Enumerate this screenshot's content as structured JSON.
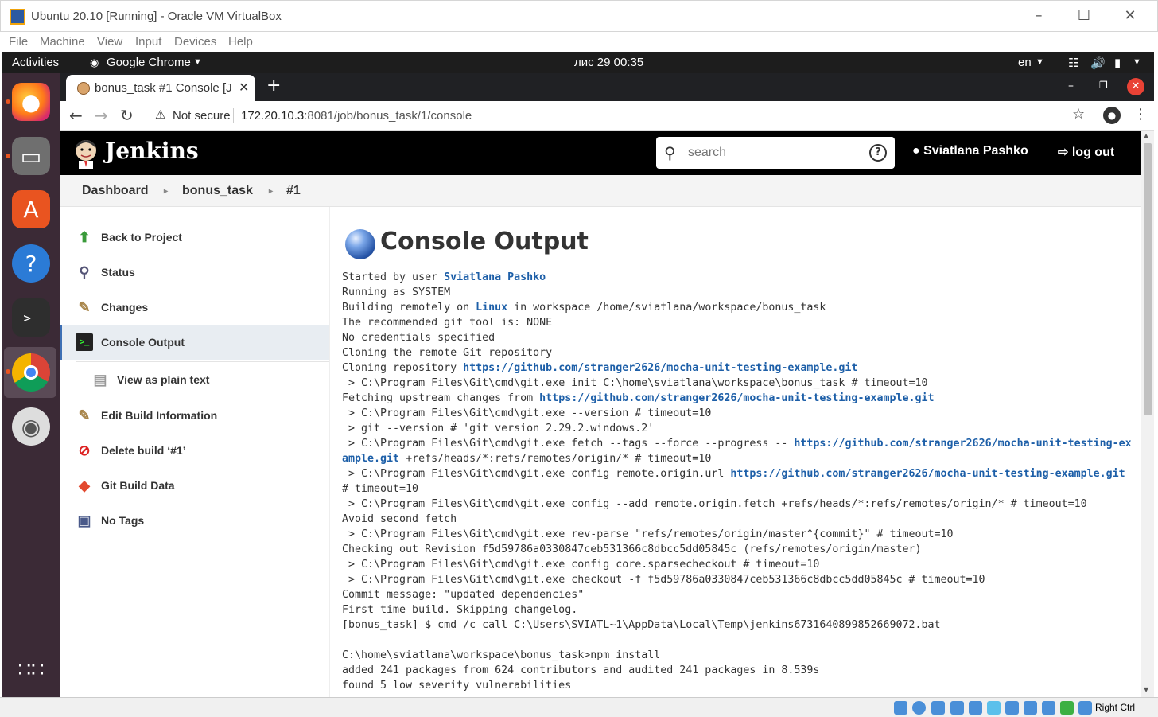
{
  "vbox": {
    "title": "Ubuntu 20.10 [Running] - Oracle VM VirtualBox",
    "menu": [
      "File",
      "Machine",
      "View",
      "Input",
      "Devices",
      "Help"
    ],
    "host_key": "Right Ctrl"
  },
  "gnome": {
    "activities": "Activities",
    "app": "Google Chrome",
    "clock": "лис 29  00:35",
    "lang": "en"
  },
  "dock": {
    "apps": [
      "firefox-icon",
      "files-icon",
      "software-icon",
      "help-icon",
      "terminal-icon",
      "chrome-icon",
      "dvd-icon",
      "app-grid-icon"
    ]
  },
  "browser": {
    "tab_title": "bonus_task #1 Console [J",
    "not_secure": "Not secure",
    "url_host": "172.20.10.3",
    "url_path": ":8081/job/bonus_task/1/console"
  },
  "jenkins": {
    "brand": "Jenkins",
    "search_placeholder": "search",
    "user": "Sviatlana Pashko",
    "logout": "log out",
    "breadcrumb": [
      "Dashboard",
      "bonus_task",
      "#1"
    ],
    "sidebar": [
      {
        "label": "Back to Project",
        "icon": "up-arrow-icon"
      },
      {
        "label": "Status",
        "icon": "magnifier-icon"
      },
      {
        "label": "Changes",
        "icon": "notepad-icon"
      },
      {
        "label": "Console Output",
        "icon": "terminal-icon"
      },
      {
        "label": "View as plain text",
        "icon": "document-icon"
      },
      {
        "label": "Edit Build Information",
        "icon": "notepad-icon"
      },
      {
        "label": "Delete build ‘#1’",
        "icon": "no-entry-icon"
      },
      {
        "label": "Git Build Data",
        "icon": "git-icon"
      },
      {
        "label": "No Tags",
        "icon": "save-icon"
      }
    ],
    "heading": "Console Output",
    "console": [
      "Started by user [Sviatlana Pashko]",
      "Running as SYSTEM",
      "Building remotely on [Linux] in workspace /home/sviatlana/workspace/bonus_task",
      "The recommended git tool is: NONE",
      "No credentials specified",
      "Cloning the remote Git repository",
      "Cloning repository [https://github.com/stranger2626/mocha-unit-testing-example.git]",
      " > C:\\Program Files\\Git\\cmd\\git.exe init C:\\home\\sviatlana\\workspace\\bonus_task # timeout=10",
      "Fetching upstream changes from [https://github.com/stranger2626/mocha-unit-testing-example.git]",
      " > C:\\Program Files\\Git\\cmd\\git.exe --version # timeout=10",
      " > git --version # 'git version 2.29.2.windows.2'",
      " > C:\\Program Files\\Git\\cmd\\git.exe fetch --tags --force --progress -- [https://github.com/stranger2626/mocha-unit-testing-example.git] +refs/heads/*:refs/remotes/origin/* # timeout=10",
      " > C:\\Program Files\\Git\\cmd\\git.exe config remote.origin.url [https://github.com/stranger2626/mocha-unit-testing-example.git] # timeout=10",
      " > C:\\Program Files\\Git\\cmd\\git.exe config --add remote.origin.fetch +refs/heads/*:refs/remotes/origin/* # timeout=10",
      "Avoid second fetch",
      " > C:\\Program Files\\Git\\cmd\\git.exe rev-parse \"refs/remotes/origin/master^{commit}\" # timeout=10",
      "Checking out Revision f5d59786a0330847ceb531366c8dbcc5dd05845c (refs/remotes/origin/master)",
      " > C:\\Program Files\\Git\\cmd\\git.exe config core.sparsecheckout # timeout=10",
      " > C:\\Program Files\\Git\\cmd\\git.exe checkout -f f5d59786a0330847ceb531366c8dbcc5dd05845c # timeout=10",
      "Commit message: \"updated dependencies\"",
      "First time build. Skipping changelog.",
      "[bonus_task] $ cmd /c call C:\\Users\\SVIATL~1\\AppData\\Local\\Temp\\jenkins6731640899852669072.bat",
      "",
      "C:\\home\\sviatlana\\workspace\\bonus_task>npm install",
      "added 241 packages from 624 contributors and audited 241 packages in 8.539s",
      "found 5 low severity vulnerabilities"
    ]
  }
}
